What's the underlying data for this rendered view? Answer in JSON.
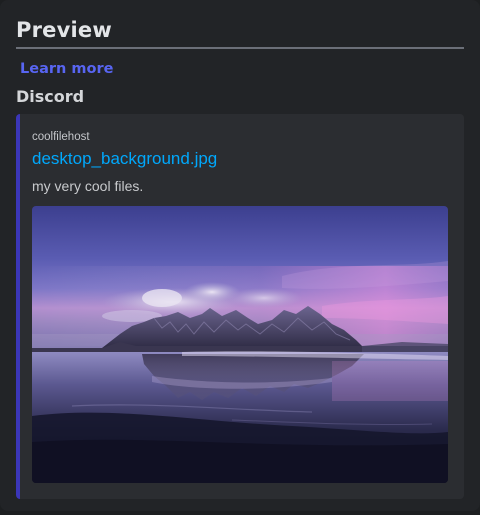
{
  "header": {
    "title": "Preview",
    "learn_more_label": "Learn more"
  },
  "section": {
    "label": "Discord"
  },
  "embed": {
    "provider": "coolfilehost",
    "title": "desktop_background.jpg",
    "description": "my very cool files.",
    "accent_color": "#3b36b8",
    "title_color": "#00a8fc",
    "image": {
      "subject": "mountain range at dusk reflected on wet beach"
    }
  },
  "colors": {
    "background": "#222427",
    "embed_background": "#2b2d31",
    "link": "#5865f2"
  }
}
